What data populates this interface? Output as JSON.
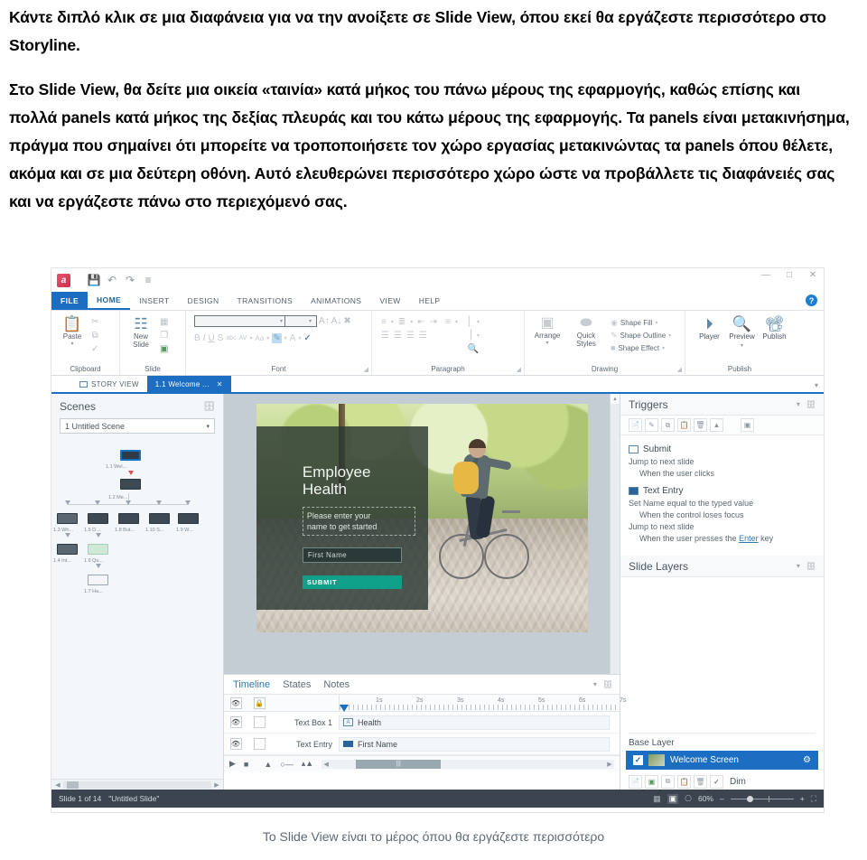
{
  "document": {
    "paragraphs": [
      "Κάντε διπλό κλικ σε μια διαφάνεια για να την ανοίξετε σε Slide View, όπου εκεί θα εργάζεστε περισσότερο στο Storyline.",
      "Στο Slide View, θα δείτε μια οικεία «ταινία» κατά μήκος του πάνω μέρους της εφαρμογής, καθώς επίσης και πολλά panels κατά μήκος της δεξίας πλευράς και του κάτω μέρους της εφαρμογής. Τα panels είναι μετακινήσημα, πράγμα που σημαίνει ότι μπορείτε να τροποποιήσετε τον χώρο εργασίας μετακινώντας τα panels όπου θέλετε, ακόμα και σε μια δεύτερη οθόνη. Αυτό ελευθερώνει περισσότερο χώρο ώστε να προβάλλετε τις διαφάνειές σας και να εργάζεστε πάνω στο περιεχόμενό σας."
    ],
    "caption": "Το Slide View είναι το μέρος όπου θα εργάζεστε περισσότερο"
  },
  "app": {
    "logo_letter": "a",
    "quick_access": [
      {
        "name": "save-icon",
        "glyph": "⬛"
      },
      {
        "name": "undo-icon",
        "glyph": "↶"
      },
      {
        "name": "redo-icon",
        "glyph": "↷"
      },
      {
        "name": "customize-qat-icon",
        "glyph": "≡"
      }
    ],
    "window_buttons": [
      {
        "name": "minimize-button",
        "glyph": "–"
      },
      {
        "name": "maximize-button",
        "glyph": "□"
      },
      {
        "name": "close-button",
        "glyph": "✕"
      }
    ],
    "help_glyph": "?",
    "tabs": [
      {
        "label": "FILE",
        "state": "file"
      },
      {
        "label": "HOME",
        "state": "active"
      },
      {
        "label": "INSERT",
        "state": "normal"
      },
      {
        "label": "DESIGN",
        "state": "normal"
      },
      {
        "label": "TRANSITIONS",
        "state": "normal"
      },
      {
        "label": "ANIMATIONS",
        "state": "normal"
      },
      {
        "label": "VIEW",
        "state": "normal"
      },
      {
        "label": "HELP",
        "state": "normal"
      }
    ],
    "ribbon": {
      "clipboard": {
        "label": "Clipboard",
        "paste": "Paste",
        "items": [
          "cut-icon",
          "copy-icon",
          "format-painter-icon"
        ]
      },
      "slide": {
        "label": "Slide",
        "new_slide": "New\nSlide",
        "new_slide_line1": "New",
        "new_slide_line2": "Slide"
      },
      "font": {
        "label": "Font",
        "font_name_value": "",
        "font_size_value": "",
        "buttons": [
          "B",
          "I",
          "U",
          "S",
          "abc",
          "AV",
          "Aa",
          "highlight",
          "A",
          "ABC"
        ]
      },
      "paragraph": {
        "label": "Paragraph"
      },
      "drawing": {
        "label": "Drawing",
        "arrange": "Arrange",
        "quick_styles_line1": "Quick",
        "quick_styles_line2": "Styles",
        "shape_fill": "Shape Fill",
        "shape_outline": "Shape Outline",
        "shape_effect": "Shape Effect"
      },
      "publish": {
        "label": "Publish",
        "player": "Player",
        "preview": "Preview",
        "publish": "Publish"
      }
    },
    "doc_tabs": {
      "story_view": "STORY VIEW",
      "slide_tab": "1.1 Welcome ...",
      "close_glyph": "✕",
      "overflow_glyph": "▾"
    },
    "scenes_panel": {
      "title": "Scenes",
      "selected_scene": "1 Untitled Scene",
      "caret": "▾",
      "nodes": [
        {
          "label": "1.1 Wel...",
          "selected": true
        },
        {
          "label": "1.2 Me...",
          "selected": false
        },
        {
          "label": "1.3 Wh...",
          "selected": false
        },
        {
          "label": "1.5 D...",
          "selected": false
        },
        {
          "label": "1.8 But...",
          "selected": false
        },
        {
          "label": "1.10 S...",
          "selected": false
        },
        {
          "label": "1.9 W...",
          "selected": false
        },
        {
          "label": "1.4 Int...",
          "selected": false
        },
        {
          "label": "1.6 Qu...",
          "selected": false
        },
        {
          "label": "1.7 Ha...",
          "selected": false
        }
      ]
    },
    "slide_content": {
      "title_line1": "Employee",
      "title_line2": "Health",
      "prompt_line1": "Please enter your",
      "prompt_line2": "name to get started",
      "input_value": "First Name",
      "submit_label": "SUBMIT"
    },
    "timeline_panel": {
      "tabs": [
        {
          "label": "Timeline",
          "active": true
        },
        {
          "label": "States",
          "active": false
        },
        {
          "label": "Notes",
          "active": false
        }
      ],
      "ruler_ticks": [
        "1s",
        "2s",
        "3s",
        "4s",
        "5s",
        "6s",
        "7s"
      ],
      "rows": [
        {
          "name": "Text Box 1",
          "object": "Health",
          "icon": "textbox-icon"
        },
        {
          "name": "Text Entry",
          "object": "First Name",
          "icon": "text-entry-icon"
        }
      ]
    },
    "triggers_panel": {
      "title": "Triggers",
      "toolbar": [
        "new-trigger-icon",
        "edit-trigger-icon",
        "copy-trigger-icon",
        "paste-trigger-icon",
        "delete-trigger-icon",
        "move-up-icon",
        "trigger-wizard-icon"
      ],
      "groups": [
        {
          "object": "Submit",
          "icon": "button-icon",
          "lines": [
            {
              "text": "Jump to next slide",
              "indent": false
            },
            {
              "text": "When the user clicks",
              "indent": true
            }
          ]
        },
        {
          "object": "Text Entry",
          "icon": "text-entry-icon",
          "lines": [
            {
              "text": "Set Name equal to the typed value",
              "indent": false
            },
            {
              "text": "When the control loses focus",
              "indent": true
            },
            {
              "text": "Jump to next slide",
              "indent": false
            },
            {
              "text": "When the user presses the Enter key",
              "indent": true,
              "link": "Enter"
            }
          ]
        }
      ]
    },
    "layers_panel": {
      "title": "Slide Layers",
      "base_layer": "Base Layer",
      "selected_layer": "Welcome Screen",
      "dim_label": "Dim",
      "toolbar": [
        "new-layer-icon",
        "edit-layer-icon",
        "copy-layer-icon",
        "paste-layer-icon",
        "delete-layer-icon"
      ]
    },
    "status_bar": {
      "slide_counter": "Slide 1 of 14",
      "slide_name": "\"Untitled Slide\"",
      "zoom_level": "60%",
      "zoom_minus": "–",
      "zoom_plus": "+",
      "views": [
        "grid-view-icon",
        "normal-view-icon",
        "presenter-view-icon"
      ],
      "fit_icon": "fit-to-window-icon"
    }
  },
  "colors": {
    "accent_blue": "#1b6ec2",
    "ribbon_text": "#4a5763",
    "status_bg": "#3c4450",
    "teal_button": "#0fa08a"
  }
}
